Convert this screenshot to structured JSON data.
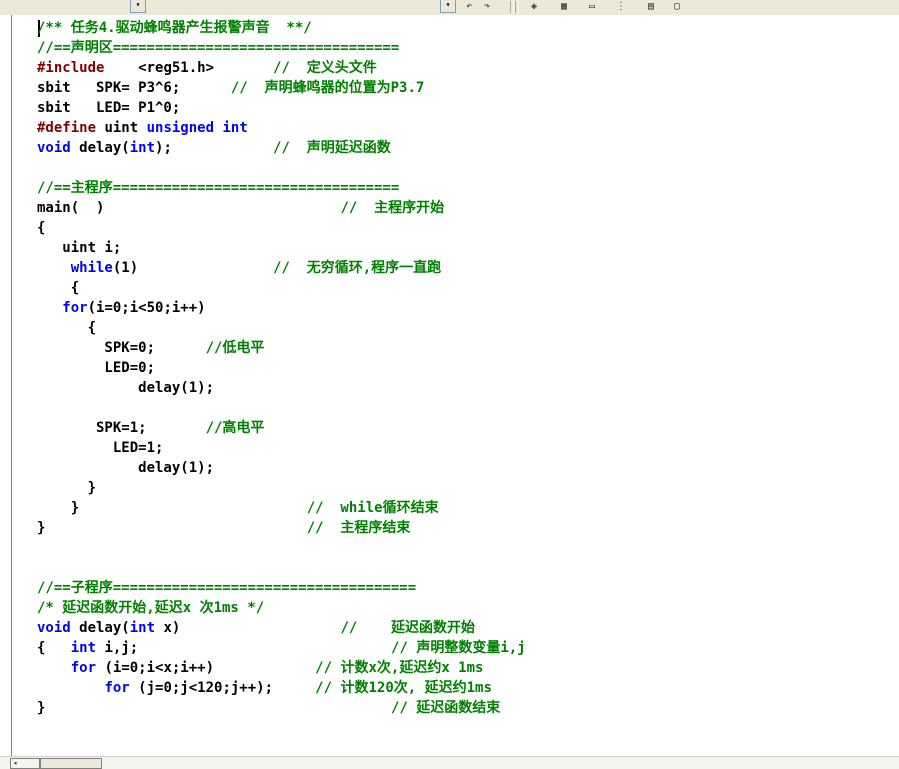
{
  "toolbar": {
    "icons": [
      "combo-dropdown",
      "undo-arrow",
      "redo-arrow",
      "view-icon",
      "grid-icon",
      "window-icon",
      "more-icon",
      "layout-icon",
      "sheet-icon"
    ],
    "dropdown_arrow": "▾"
  },
  "editor": {
    "lines": [
      {
        "segs": [
          {
            "t": "/** 任务4.驱动蜂鸣器产生报警声音  **/",
            "c": "cm"
          }
        ]
      },
      {
        "segs": [
          {
            "t": "//==声明区==================================",
            "c": "cm"
          }
        ]
      },
      {
        "segs": [
          {
            "t": "#include",
            "c": "pp"
          },
          {
            "t": "    <reg51.h>       "
          },
          {
            "t": "//  定义头文件",
            "c": "cm"
          }
        ]
      },
      {
        "segs": [
          {
            "t": "sbit   SPK= P3^6;      "
          },
          {
            "t": "//  声明蜂鸣器的位置为P3.7",
            "c": "cm"
          }
        ]
      },
      {
        "segs": [
          {
            "t": "sbit   LED= P1^0;"
          }
        ]
      },
      {
        "segs": [
          {
            "t": "#define",
            "c": "pp"
          },
          {
            "t": " uint "
          },
          {
            "t": "unsigned",
            "c": "kw"
          },
          {
            "t": " "
          },
          {
            "t": "int",
            "c": "kw"
          }
        ]
      },
      {
        "segs": [
          {
            "t": "void",
            "c": "kw"
          },
          {
            "t": " delay("
          },
          {
            "t": "int",
            "c": "kw"
          },
          {
            "t": ");            "
          },
          {
            "t": "//  声明延迟函数",
            "c": "cm"
          }
        ]
      },
      {
        "segs": []
      },
      {
        "segs": [
          {
            "t": "//==主程序==================================",
            "c": "cm"
          }
        ]
      },
      {
        "segs": [
          {
            "t": "main(  )                            "
          },
          {
            "t": "//  主程序开始",
            "c": "cm"
          }
        ]
      },
      {
        "segs": [
          {
            "t": "{"
          }
        ]
      },
      {
        "segs": [
          {
            "t": "   uint i;"
          }
        ]
      },
      {
        "segs": [
          {
            "t": "    "
          },
          {
            "t": "while",
            "c": "kw"
          },
          {
            "t": "(1)                "
          },
          {
            "t": "//  无穷循环,程序一直跑",
            "c": "cm"
          }
        ]
      },
      {
        "segs": [
          {
            "t": "    {"
          }
        ]
      },
      {
        "segs": [
          {
            "t": "   "
          },
          {
            "t": "for",
            "c": "kw"
          },
          {
            "t": "(i=0;i<50;i++)"
          }
        ]
      },
      {
        "segs": [
          {
            "t": "      {"
          }
        ]
      },
      {
        "segs": [
          {
            "t": "        SPK=0;      "
          },
          {
            "t": "//低电平",
            "c": "cm"
          }
        ]
      },
      {
        "segs": [
          {
            "t": "        LED=0;"
          }
        ]
      },
      {
        "segs": [
          {
            "t": "            delay(1);"
          }
        ]
      },
      {
        "segs": []
      },
      {
        "segs": [
          {
            "t": "       SPK=1;       "
          },
          {
            "t": "//高电平",
            "c": "cm"
          }
        ]
      },
      {
        "segs": [
          {
            "t": "         LED=1;"
          }
        ]
      },
      {
        "segs": [
          {
            "t": "            delay(1);"
          }
        ]
      },
      {
        "segs": [
          {
            "t": "      }"
          }
        ]
      },
      {
        "segs": [
          {
            "t": "    }                           "
          },
          {
            "t": "//  while循环结束",
            "c": "cm"
          }
        ]
      },
      {
        "segs": [
          {
            "t": "}                               "
          },
          {
            "t": "//  主程序结束",
            "c": "cm"
          }
        ]
      },
      {
        "segs": []
      },
      {
        "segs": []
      },
      {
        "segs": [
          {
            "t": "//==子程序====================================",
            "c": "cm"
          }
        ]
      },
      {
        "segs": [
          {
            "t": "/* 延迟函数开始,延迟x 次1ms */",
            "c": "cm"
          }
        ]
      },
      {
        "segs": [
          {
            "t": "void",
            "c": "kw"
          },
          {
            "t": " delay("
          },
          {
            "t": "int",
            "c": "kw"
          },
          {
            "t": " x)                   "
          },
          {
            "t": "//    延迟函数开始",
            "c": "cm"
          }
        ]
      },
      {
        "segs": [
          {
            "t": "{   "
          },
          {
            "t": "int",
            "c": "kw"
          },
          {
            "t": " i,j;                              "
          },
          {
            "t": "// 声明整数变量i,j",
            "c": "cm"
          }
        ]
      },
      {
        "segs": [
          {
            "t": "    "
          },
          {
            "t": "for",
            "c": "kw"
          },
          {
            "t": " (i=0;i<x;i++)            "
          },
          {
            "t": "// 计数x次,延迟约x 1ms",
            "c": "cm"
          }
        ]
      },
      {
        "segs": [
          {
            "t": "        "
          },
          {
            "t": "for",
            "c": "kw"
          },
          {
            "t": " (j=0;j<120;j++);     "
          },
          {
            "t": "// 计数120次, 延迟约1ms",
            "c": "cm"
          }
        ]
      },
      {
        "segs": [
          {
            "t": "}                                         "
          },
          {
            "t": "// 延迟函数结束",
            "c": "cm"
          }
        ]
      }
    ]
  },
  "scrollbar": {
    "left_glyph": "◂"
  }
}
